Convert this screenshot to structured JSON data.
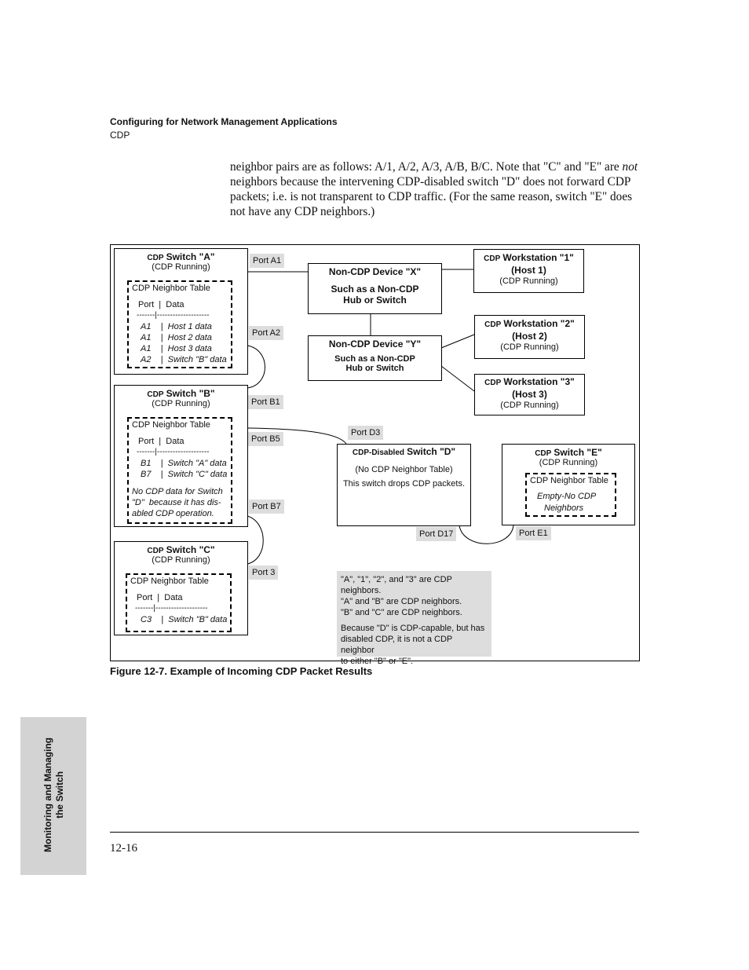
{
  "header": {
    "chapter": "Configuring for Network Management Applications",
    "section": "CDP"
  },
  "body": {
    "pre": "neighbor  pairs are as follows: A/1, A/2, A/3, A/B, B/C. Note that \"C\" and \"E\" are ",
    "em": "not",
    "post": " neighbors because the intervening CDP-disabled switch \"D\" does not forward CDP packets; i.e. is not transparent to CDP traffic. (For the same reason, switch \"E\" does not have any CDP neighbors.)"
  },
  "diagram": {
    "switch_a": {
      "prefix": "CDP",
      "title": "Switch \"A\"",
      "status": "(CDP Running)",
      "table_title": "CDP Neighbor Table",
      "table_header": "Port  |  Data",
      "sep": "-------|--------------------",
      "rows": [
        "A1    |  Host 1 data",
        "A1    |  Host 2 data",
        "A1    |  Host 3 data",
        "A2    |  Switch \"B\" data"
      ]
    },
    "switch_b": {
      "prefix": "CDP",
      "title": "Switch \"B\"",
      "status": "(CDP Running)",
      "table_title": "CDP Neighbor Table",
      "table_header": "Port  |  Data",
      "sep": "-------|--------------------",
      "rows": [
        "B1    |  Switch \"A\" data",
        "B7    |  Switch \"C\" data"
      ],
      "note": "No CDP data for Switch\n\"D\"  because it has dis-\nabled CDP operation."
    },
    "switch_c": {
      "prefix": "CDP",
      "title": "Switch \"C\"",
      "status": "(CDP Running)",
      "table_title": "CDP Neighbor Table",
      "table_header": "Port  |  Data",
      "sep": "-------|--------------------",
      "rows": [
        "C3    |  Switch \"B\" data"
      ]
    },
    "device_x": {
      "title": "Non-CDP Device \"X\"",
      "sub1": "Such as a Non-CDP",
      "sub2": "Hub or Switch"
    },
    "device_y": {
      "title": "Non-CDP Device \"Y\"",
      "sub1": "Such as a Non-CDP",
      "sub2": "Hub or Switch"
    },
    "ws1": {
      "prefix": "CDP",
      "title": "Workstation \"1\"",
      "host": "(Host 1)",
      "status": "(CDP Running)"
    },
    "ws2": {
      "prefix": "CDP",
      "title": "Workstation \"2\"",
      "host": "(Host 2)",
      "status": "(CDP Running)"
    },
    "ws3": {
      "prefix": "CDP",
      "title": "Workstation \"3\"",
      "host": "(Host 3)",
      "status": "(CDP Running)"
    },
    "switch_d": {
      "prefix": "CDP-Disabled",
      "title": "Switch \"D\"",
      "line1": "(No CDP Neighbor Table)",
      "line2": "This switch drops CDP packets."
    },
    "switch_e": {
      "prefix": "CDP",
      "title": "Switch \"E\"",
      "status": "(CDP Running)",
      "table_title": "CDP Neighbor Table",
      "empty1": "Empty-No CDP",
      "empty2": "Neighbors"
    },
    "ports": {
      "a1": "Port A1",
      "a2": "Port A2",
      "b1": "Port B1",
      "b5": "Port B5",
      "b7": "Port B7",
      "p3": "Port 3",
      "d3": "Port D3",
      "d17": "Port D17",
      "e1": "Port E1"
    },
    "legend": {
      "l1": "\"A\", \"1\", \"2\", and \"3\" are CDP neighbors.",
      "l2": "\"A\" and \"B\" are CDP neighbors.",
      "l3": "\"B\" and \"C\" are CDP neighbors.",
      "l4": "Because \"D\" is CDP-capable, but has",
      "l5": "disabled CDP, it is not a CDP neighbor",
      "l6": "to either \"B\" or \"E\"."
    }
  },
  "caption": "Figure 12-7.   Example of Incoming CDP Packet Results",
  "side_tab": {
    "line1": "Monitoring and Managing",
    "line2": "the Switch"
  },
  "page_number": "12-16"
}
